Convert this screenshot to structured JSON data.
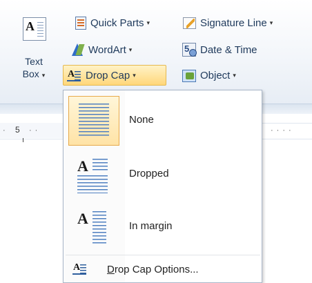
{
  "ribbon": {
    "text_box": {
      "line1": "Text",
      "line2": "Box",
      "arrow": "▾",
      "icon": "text-box-icon"
    },
    "quick_parts": {
      "label": "Quick Parts",
      "arrow": "▾",
      "icon": "quick-parts-icon"
    },
    "signature_line": {
      "label": "Signature Line",
      "arrow": "▾",
      "icon": "signature-line-icon"
    },
    "wordart": {
      "label": "WordArt",
      "arrow": "▾",
      "icon": "wordart-icon"
    },
    "date_time": {
      "label": "Date & Time",
      "icon": "date-time-icon"
    },
    "drop_cap": {
      "label": "Drop Cap",
      "arrow": "▾",
      "icon": "drop-cap-icon",
      "highlight_color": "#ffd77a"
    },
    "object": {
      "label": "Object",
      "arrow": "▾",
      "icon": "object-icon"
    }
  },
  "ruler": {
    "number": "5"
  },
  "menu": {
    "items": [
      {
        "label": "None",
        "icon": "drop-cap-none-icon",
        "selected": true
      },
      {
        "label": "Dropped",
        "icon": "drop-cap-dropped-icon",
        "selected": false
      },
      {
        "label": "In margin",
        "icon": "drop-cap-in-margin-icon",
        "selected": false
      }
    ],
    "options": {
      "label_first": "D",
      "label_rest": "rop Cap Options...",
      "icon": "drop-cap-options-icon"
    }
  },
  "colors": {
    "accent": "#e7a94a",
    "line_blue": "#4e7fc0",
    "text": "#1e395b"
  }
}
